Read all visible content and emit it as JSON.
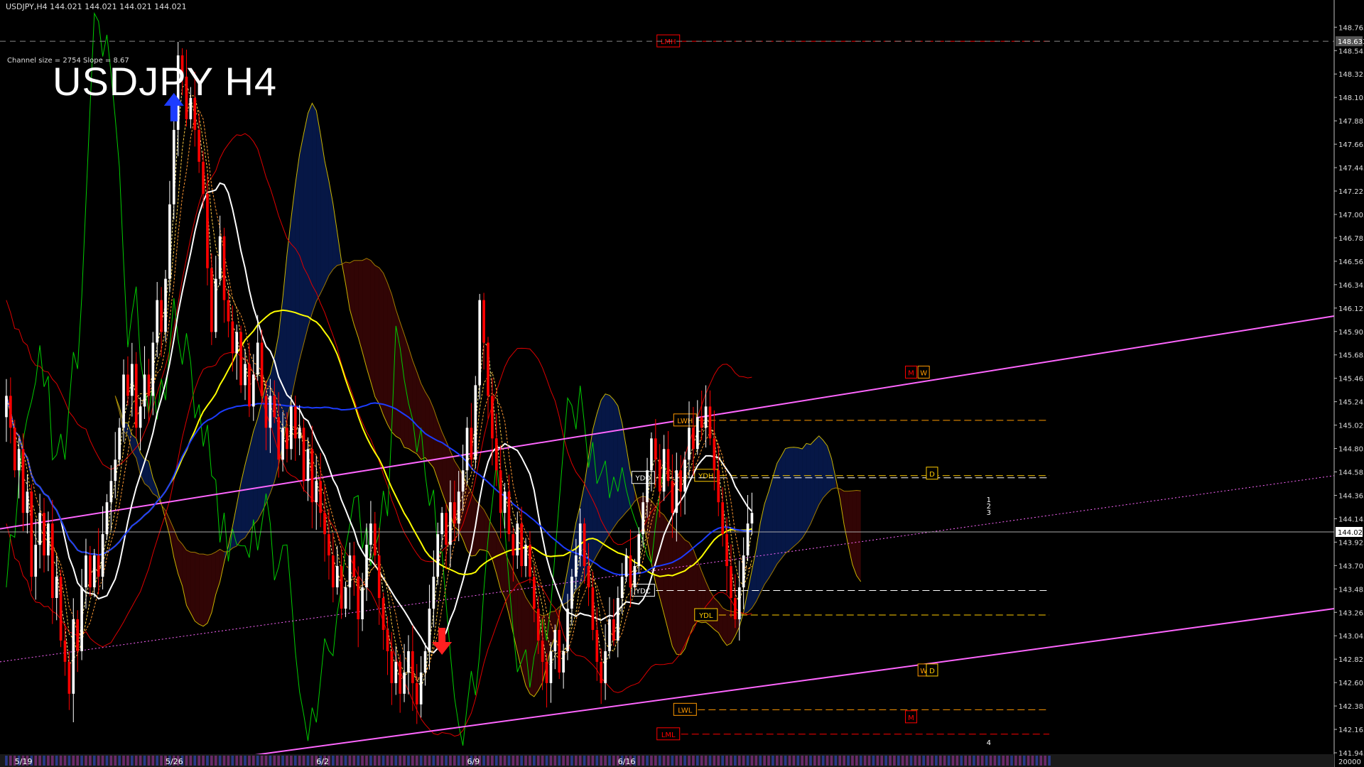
{
  "header": {
    "text": "USDJPY,H4  144.021 144.021 144.021 144.021"
  },
  "big_title": "USDJPY H4",
  "channel_info": "Channel size = 2754 Slope = 8.67",
  "colors": {
    "background": "#000000",
    "bull": "#ffffff",
    "bear": "#ff0000",
    "channel": "#ff66ff",
    "ma_white": "#ffffff",
    "ma_yellow": "#ffff00",
    "ma_blue": "#1c3cff",
    "chikou": "#00cc00",
    "envelope": "#dd0000"
  },
  "chart_data": {
    "type": "candlestick",
    "symbol": "USDJPY",
    "timeframe": "H4",
    "ylim": [
      141.945,
      148.767
    ],
    "y_ticks": [
      "148.765",
      "148.545",
      "148.325",
      "148.105",
      "147.885",
      "147.665",
      "147.445",
      "147.225",
      "147.005",
      "146.785",
      "146.565",
      "146.345",
      "146.125",
      "145.905",
      "145.685",
      "145.465",
      "145.245",
      "145.025",
      "144.805",
      "144.585",
      "144.365",
      "144.145",
      "143.925",
      "143.705",
      "143.485",
      "143.265",
      "143.045",
      "142.825",
      "142.605",
      "142.385",
      "142.165",
      "141.945"
    ],
    "current_price": "144.021",
    "top_price_label": "148.633",
    "volume_label": "20000",
    "x_labels": [
      {
        "label": "5/19",
        "index": 2
      },
      {
        "label": "5/26",
        "index": 38
      },
      {
        "label": "6/2",
        "index": 74
      },
      {
        "label": "6/9",
        "index": 110
      },
      {
        "label": "6/16",
        "index": 146
      }
    ],
    "levels": [
      {
        "label": "LMH",
        "price": 148.633,
        "color": "#ff0000",
        "start": 156,
        "end": 250
      },
      {
        "label": "LWH",
        "price": 145.07,
        "color": "#ff9900",
        "start": 160,
        "end": 250
      },
      {
        "label": "YDH",
        "price": 144.55,
        "color": "#ffcc00",
        "start": 165,
        "end": 250
      },
      {
        "label": "YDO",
        "price": 144.53,
        "color": "#ffffff",
        "start": 150,
        "end": 250
      },
      {
        "label": "YDC",
        "price": 143.47,
        "color": "#ffffff",
        "start": 150,
        "end": 250
      },
      {
        "label": "YDL",
        "price": 143.24,
        "color": "#ffcc00",
        "start": 165,
        "end": 250
      },
      {
        "label": "LWL",
        "price": 142.35,
        "color": "#ff9900",
        "start": 160,
        "end": 250
      },
      {
        "label": "LML",
        "price": 142.12,
        "color": "#ff0000",
        "start": 156,
        "end": 250
      }
    ],
    "side_markers": [
      {
        "label": "M",
        "price": 145.52,
        "color": "#ff0000",
        "index": 216
      },
      {
        "label": "W",
        "price": 145.52,
        "color": "#ff9900",
        "index": 219
      },
      {
        "label": "D",
        "price": 144.57,
        "color": "#ffcc00",
        "index": 221
      },
      {
        "label": "W",
        "price": 142.72,
        "color": "#ff9900",
        "index": 219
      },
      {
        "label": "D",
        "price": 142.72,
        "color": "#ffcc00",
        "index": 221
      },
      {
        "label": "M",
        "price": 142.28,
        "color": "#ff0000",
        "index": 216
      }
    ],
    "projection_labels": [
      {
        "label": "1",
        "price": 144.3,
        "index": 234
      },
      {
        "label": "2",
        "price": 144.24,
        "index": 234
      },
      {
        "label": "3",
        "price": 144.18,
        "index": 234
      },
      {
        "label": "4",
        "price": 142.02,
        "index": 234
      }
    ],
    "closes": [
      145.3,
      145.0,
      144.6,
      144.8,
      144.2,
      144.4,
      143.6,
      143.9,
      144.2,
      143.8,
      144.1,
      143.4,
      143.6,
      143.0,
      142.8,
      142.5,
      143.2,
      142.9,
      143.5,
      143.8,
      143.5,
      143.8,
      143.6,
      144.0,
      144.3,
      144.5,
      144.7,
      145.0,
      145.5,
      145.3,
      145.6,
      145.0,
      145.2,
      145.5,
      145.3,
      145.8,
      146.2,
      145.9,
      146.4,
      147.1,
      147.8,
      148.5,
      148.3,
      147.9,
      148.1,
      147.8,
      147.5,
      147.2,
      146.5,
      145.9,
      146.4,
      146.8,
      146.2,
      146.0,
      145.7,
      145.9,
      145.4,
      145.6,
      145.2,
      145.5,
      145.8,
      145.3,
      145.0,
      145.3,
      145.1,
      144.7,
      145.0,
      144.8,
      145.2,
      144.9,
      145.0,
      144.5,
      144.8,
      144.3,
      144.5,
      144.2,
      144.0,
      143.8,
      143.5,
      143.7,
      143.3,
      143.5,
      143.8,
      143.6,
      143.2,
      143.5,
      143.9,
      144.1,
      143.8,
      143.4,
      143.1,
      142.9,
      142.6,
      142.8,
      142.5,
      142.7,
      142.9,
      142.6,
      142.4,
      142.7,
      142.9,
      143.3,
      143.6,
      144.0,
      144.2,
      143.9,
      144.3,
      144.1,
      144.4,
      144.6,
      145.0,
      144.7,
      145.4,
      146.2,
      145.8,
      145.3,
      144.9,
      144.6,
      144.2,
      144.4,
      144.0,
      143.8,
      144.1,
      143.7,
      143.9,
      143.6,
      143.3,
      143.0,
      142.8,
      142.6,
      142.9,
      143.1,
      142.7,
      142.9,
      143.3,
      143.6,
      143.8,
      144.1,
      143.7,
      143.5,
      143.1,
      142.8,
      142.6,
      142.9,
      143.2,
      143.0,
      143.4,
      143.6,
      143.8,
      143.5,
      143.7,
      144.0,
      144.3,
      144.6,
      144.9,
      144.7,
      144.4,
      144.8,
      144.5,
      144.2,
      144.6,
      144.4,
      144.7,
      145.0,
      144.8,
      145.1,
      145.0,
      145.2,
      144.9,
      144.6,
      144.3,
      144.0,
      143.7,
      143.4,
      143.2,
      143.5,
      143.8,
      144.1,
      144.2
    ]
  }
}
